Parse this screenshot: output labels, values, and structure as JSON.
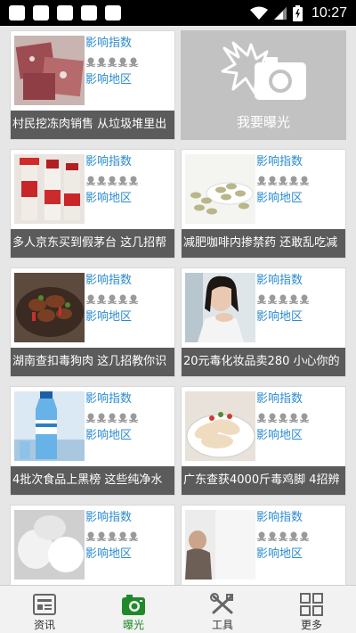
{
  "status_bar": {
    "time": "10:27"
  },
  "cards": [
    {
      "id": "frozen-meat",
      "index_label": "影响指数",
      "region_label": "影响地区",
      "caption": "村民挖冻肉销售 从垃圾堆里出",
      "skull_count": 5,
      "image": "frozen-meat-photo"
    },
    {
      "id": "maotai",
      "index_label": "影响指数",
      "region_label": "影响地区",
      "caption": "多人京东买到假茅台 这几招帮",
      "skull_count": 5,
      "image": "liquor-bottles-photo"
    },
    {
      "id": "coffee",
      "index_label": "影响指数",
      "region_label": "影响地区",
      "caption": "减肥咖啡内掺禁药 还敢乱吃减",
      "skull_count": 5,
      "image": "pills-photo"
    },
    {
      "id": "dog-meat",
      "index_label": "影响指数",
      "region_label": "影响地区",
      "caption": "湖南查扣毒狗肉 这几招教你识",
      "skull_count": 5,
      "image": "stewed-meat-photo"
    },
    {
      "id": "cosmetics",
      "index_label": "影响指数",
      "region_label": "影响地区",
      "caption": "20元毒化妆品卖280 小心你的",
      "skull_count": 5,
      "image": "woman-photo"
    },
    {
      "id": "blacklist",
      "index_label": "影响指数",
      "region_label": "影响地区",
      "caption": "4批次食品上黑榜 这些纯净水",
      "skull_count": 5,
      "image": "water-bottle-photo"
    },
    {
      "id": "chicken-feet",
      "index_label": "影响指数",
      "region_label": "影响地区",
      "caption": "广东查获4000斤毒鸡脚 4招辨",
      "skull_count": 5,
      "image": "chicken-feet-photo"
    },
    {
      "id": "row5-left",
      "index_label": "影响指数",
      "region_label": "影响地区",
      "caption": "",
      "skull_count": 5,
      "image": "white-items-photo"
    },
    {
      "id": "row5-right",
      "index_label": "影响指数",
      "region_label": "影响地区",
      "caption": "",
      "skull_count": 5,
      "image": "person-photo"
    }
  ],
  "expose": {
    "label": "我要曝光",
    "icon": "camera-icon"
  },
  "nav": [
    {
      "label": "资讯",
      "icon": "news-icon",
      "active": false
    },
    {
      "label": "曝光",
      "icon": "camera-icon",
      "active": true
    },
    {
      "label": "工具",
      "icon": "tools-icon",
      "active": false
    },
    {
      "label": "更多",
      "icon": "grid-icon",
      "active": false
    }
  ],
  "colors": {
    "accent_blue": "#2b8bd0",
    "caption_bg": "#5b5b5b",
    "active_green": "#1f8a2a",
    "expose_bg": "#c2c2c2"
  }
}
